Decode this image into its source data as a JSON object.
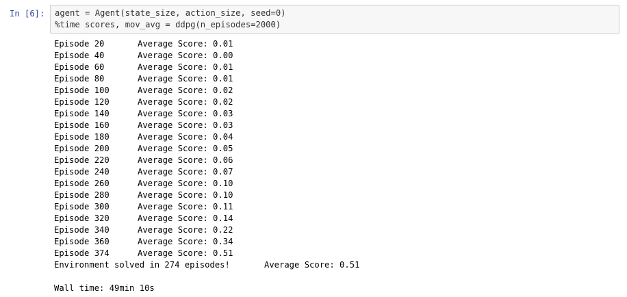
{
  "cell": {
    "prompt": "In [6]:",
    "code": [
      "agent = Agent(state_size, action_size, seed=0)",
      "%time scores, mov_avg = ddpg(n_episodes=2000)"
    ]
  },
  "output": {
    "episodes": [
      {
        "episode": "Episode 20",
        "score": "Average Score: 0.01"
      },
      {
        "episode": "Episode 40",
        "score": "Average Score: 0.00"
      },
      {
        "episode": "Episode 60",
        "score": "Average Score: 0.01"
      },
      {
        "episode": "Episode 80",
        "score": "Average Score: 0.01"
      },
      {
        "episode": "Episode 100",
        "score": "Average Score: 0.02"
      },
      {
        "episode": "Episode 120",
        "score": "Average Score: 0.02"
      },
      {
        "episode": "Episode 140",
        "score": "Average Score: 0.03"
      },
      {
        "episode": "Episode 160",
        "score": "Average Score: 0.03"
      },
      {
        "episode": "Episode 180",
        "score": "Average Score: 0.04"
      },
      {
        "episode": "Episode 200",
        "score": "Average Score: 0.05"
      },
      {
        "episode": "Episode 220",
        "score": "Average Score: 0.06"
      },
      {
        "episode": "Episode 240",
        "score": "Average Score: 0.07"
      },
      {
        "episode": "Episode 260",
        "score": "Average Score: 0.10"
      },
      {
        "episode": "Episode 280",
        "score": "Average Score: 0.10"
      },
      {
        "episode": "Episode 300",
        "score": "Average Score: 0.11"
      },
      {
        "episode": "Episode 320",
        "score": "Average Score: 0.14"
      },
      {
        "episode": "Episode 340",
        "score": "Average Score: 0.22"
      },
      {
        "episode": "Episode 360",
        "score": "Average Score: 0.34"
      },
      {
        "episode": "Episode 374",
        "score": "Average Score: 0.51"
      }
    ],
    "solved": {
      "message": "Environment solved in 274 episodes!",
      "score": "Average Score: 0.51"
    },
    "wall_time": "Wall time: 49min 10s"
  },
  "colors": {
    "prompt": "#303f9f",
    "input_bg": "#f7f7f7",
    "input_border": "#cfcfcf"
  }
}
